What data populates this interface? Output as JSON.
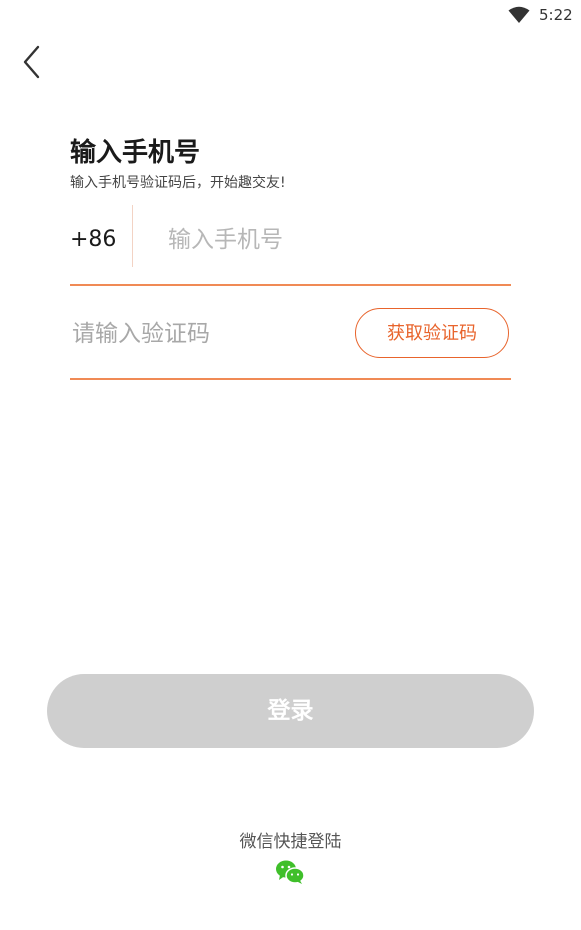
{
  "status_bar": {
    "time": "5:22",
    "wifi_icon": "wifi-icon"
  },
  "nav": {
    "back_icon": "chevron-left-icon"
  },
  "header": {
    "title": "输入手机号",
    "subtitle": "输入手机号验证码后，开始趣交友!"
  },
  "phone": {
    "country_code": "+86",
    "placeholder": "输入手机号",
    "value": ""
  },
  "verification": {
    "placeholder": "请输入验证码",
    "value": "",
    "get_code_label": "获取验证码"
  },
  "login": {
    "label": "登录"
  },
  "wechat": {
    "label": "微信快捷登陆",
    "icon": "wechat-icon"
  },
  "colors": {
    "accent": "#e8642c",
    "underline": "#f08a55",
    "login_disabled": "#cfcfcf",
    "wechat_green": "#3fbf2a"
  }
}
